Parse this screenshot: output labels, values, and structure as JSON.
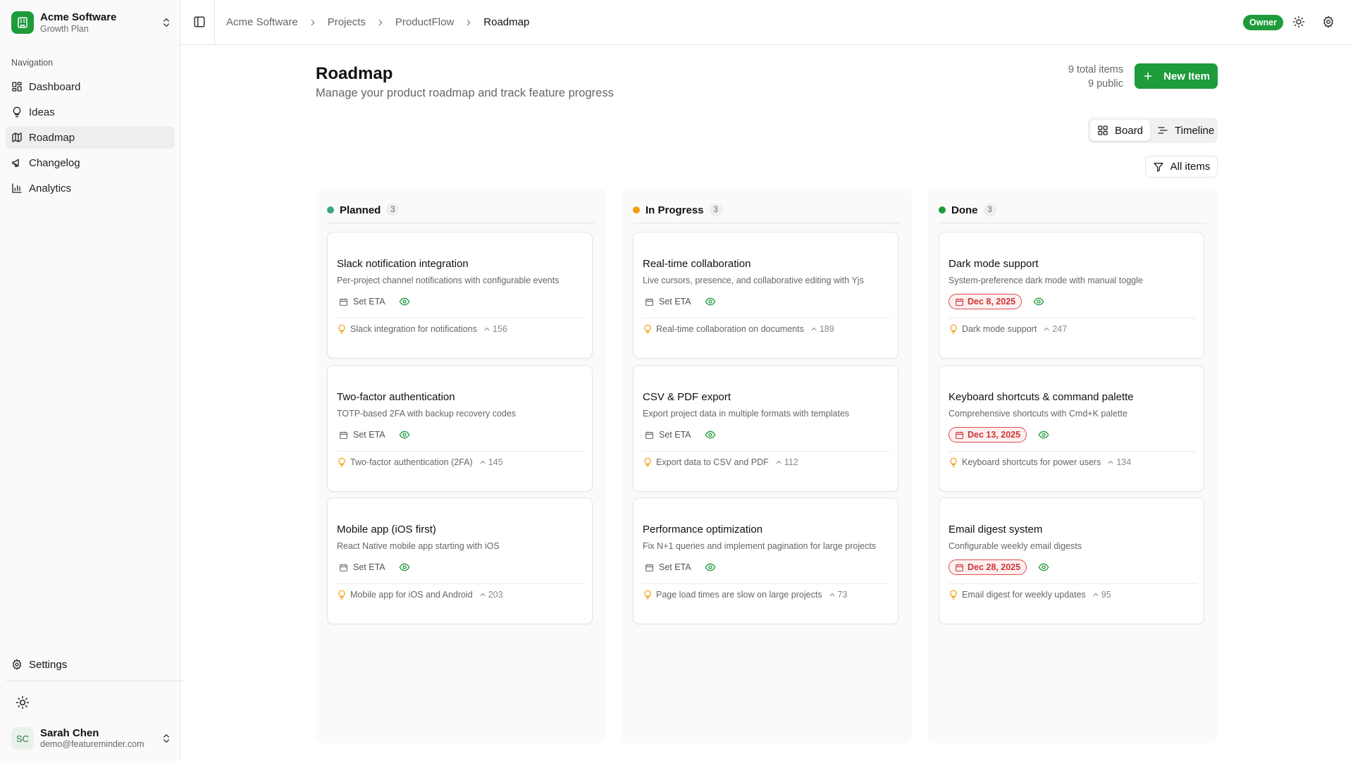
{
  "org": {
    "name": "Acme Software",
    "plan": "Growth Plan"
  },
  "sidebar": {
    "section_label": "Navigation",
    "items": [
      {
        "label": "Dashboard",
        "icon": "dashboard-icon",
        "active": false
      },
      {
        "label": "Ideas",
        "icon": "lightbulb-icon",
        "active": false
      },
      {
        "label": "Roadmap",
        "icon": "map-icon",
        "active": true
      },
      {
        "label": "Changelog",
        "icon": "megaphone-icon",
        "active": false
      },
      {
        "label": "Analytics",
        "icon": "bar-chart-icon",
        "active": false
      }
    ],
    "settings_label": "Settings"
  },
  "user": {
    "initials": "SC",
    "name": "Sarah Chen",
    "email": "demo@featureminder.com"
  },
  "breadcrumb": [
    "Acme Software",
    "Projects",
    "ProductFlow",
    "Roadmap"
  ],
  "header": {
    "role_badge": "Owner"
  },
  "page": {
    "title": "Roadmap",
    "subtitle": "Manage your product roadmap and track feature progress",
    "total_items": "9 total items",
    "public_items": "9 public",
    "new_button": "New Item",
    "view_board": "Board",
    "view_timeline": "Timeline",
    "filter_label": "All items"
  },
  "colors": {
    "accent": "#1e9b3a",
    "planned": "#3aa87a",
    "in_progress": "#f59e0b",
    "done": "#1e9b3a",
    "eta_overdue": "#d03535"
  },
  "columns": [
    {
      "title": "Planned",
      "count": "3",
      "cards": [
        {
          "title": "Slack notification integration",
          "desc": "Per-project channel notifications with configurable events",
          "eta": "Set ETA",
          "idea": "Slack integration for notifications",
          "votes": "156"
        },
        {
          "title": "Two-factor authentication",
          "desc": "TOTP-based 2FA with backup recovery codes",
          "eta": "Set ETA",
          "idea": "Two-factor authentication (2FA)",
          "votes": "145"
        },
        {
          "title": "Mobile app (iOS first)",
          "desc": "React Native mobile app starting with iOS",
          "eta": "Set ETA",
          "idea": "Mobile app for iOS and Android",
          "votes": "203"
        }
      ]
    },
    {
      "title": "In Progress",
      "count": "3",
      "cards": [
        {
          "title": "Real-time collaboration",
          "desc": "Live cursors, presence, and collaborative editing with Yjs",
          "eta": "Set ETA",
          "idea": "Real-time collaboration on documents",
          "votes": "189"
        },
        {
          "title": "CSV & PDF export",
          "desc": "Export project data in multiple formats with templates",
          "eta": "Set ETA",
          "idea": "Export data to CSV and PDF",
          "votes": "112"
        },
        {
          "title": "Performance optimization",
          "desc": "Fix N+1 queries and implement pagination for large projects",
          "eta": "Set ETA",
          "idea": "Page load times are slow on large projects",
          "votes": "73"
        }
      ]
    },
    {
      "title": "Done",
      "count": "3",
      "cards": [
        {
          "title": "Dark mode support",
          "desc": "System-preference dark mode with manual toggle",
          "eta": "Dec 8, 2025",
          "idea": "Dark mode support",
          "votes": "247"
        },
        {
          "title": "Keyboard shortcuts & command palette",
          "desc": "Comprehensive shortcuts with Cmd+K palette",
          "eta": "Dec 13, 2025",
          "idea": "Keyboard shortcuts for power users",
          "votes": "134"
        },
        {
          "title": "Email digest system",
          "desc": "Configurable weekly email digests",
          "eta": "Dec 28, 2025",
          "idea": "Email digest for weekly updates",
          "votes": "95"
        }
      ]
    }
  ]
}
